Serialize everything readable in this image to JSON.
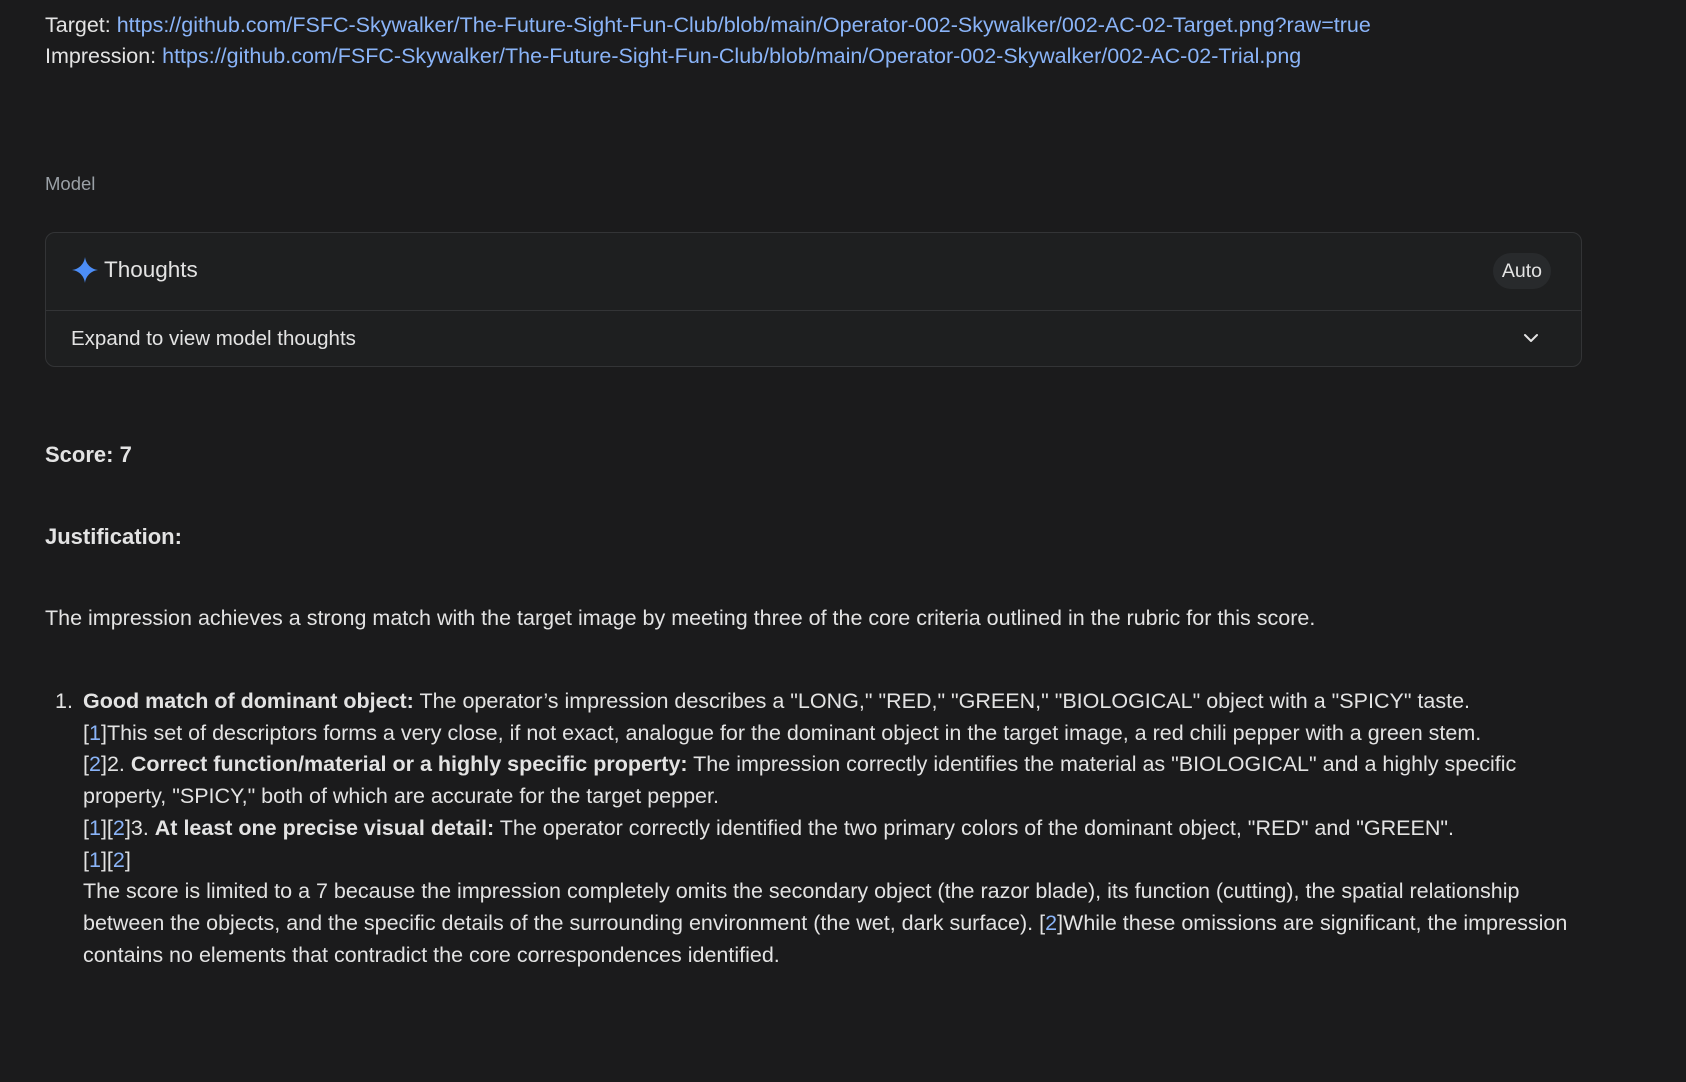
{
  "links": {
    "target_label": "Target:",
    "target_url": "https://github.com/FSFC-Skywalker/The-Future-Sight-Fun-Club/blob/main/Operator-002-Skywalker/002-AC-02-Target.png?raw=true",
    "impression_label": "Impression:",
    "impression_url": "https://github.com/FSFC-Skywalker/The-Future-Sight-Fun-Club/blob/main/Operator-002-Skywalker/002-AC-02-Trial.png"
  },
  "model_label": "Model",
  "thoughts": {
    "title": "Thoughts",
    "badge": "Auto",
    "expand_label": "Expand to view model thoughts",
    "icon": "sparkle-icon",
    "accent_color": "#4c8df6"
  },
  "response": {
    "score": "Score: 7",
    "justification_heading": "Justification:",
    "intro": "The impression achieves a strong match with the target image by meeting three of the core criteria outlined in the rubric for this score.",
    "list_number": "1.",
    "item1_title": "Good match of dominant object:",
    "item1_text": " The operator’s impression describes a \"LONG,\" \"RED,\" \"GREEN,\" \"BIOLOGICAL\" object with a \"SPICY\" taste.",
    "item1_cont": "This set of descriptors forms a very close, if not exact, analogue for the dominant object in the target image, a red chili pepper with a green stem.",
    "item2_prefix": "2.",
    "item2_title": "Correct function/material or a highly specific property:",
    "item2_text": " The impression correctly identifies the material as \"BIOLOGICAL\" and a highly specific property, \"SPICY,\" both of which are accurate for the target pepper.",
    "item3_prefix": "3.",
    "item3_title": "At least one precise visual detail:",
    "item3_text": " The operator correctly identified the two primary colors of the dominant object, \"RED\" and \"GREEN\".",
    "closing_text": "The score is limited to a 7 because the impression completely omits the secondary object (the razor blade), its function (cutting), the spatial relationship between the objects, and the specific details of the surrounding environment (the wet, dark surface).",
    "closing_tail": "While these omissions are significant, the impression contains no elements that contradict the core correspondences identified.",
    "cite1": "1",
    "cite2": "2"
  },
  "colors": {
    "background": "#1b1b1c",
    "text": "#e3e3e3",
    "link": "#8ab4f8",
    "muted": "#9aa0a6"
  }
}
